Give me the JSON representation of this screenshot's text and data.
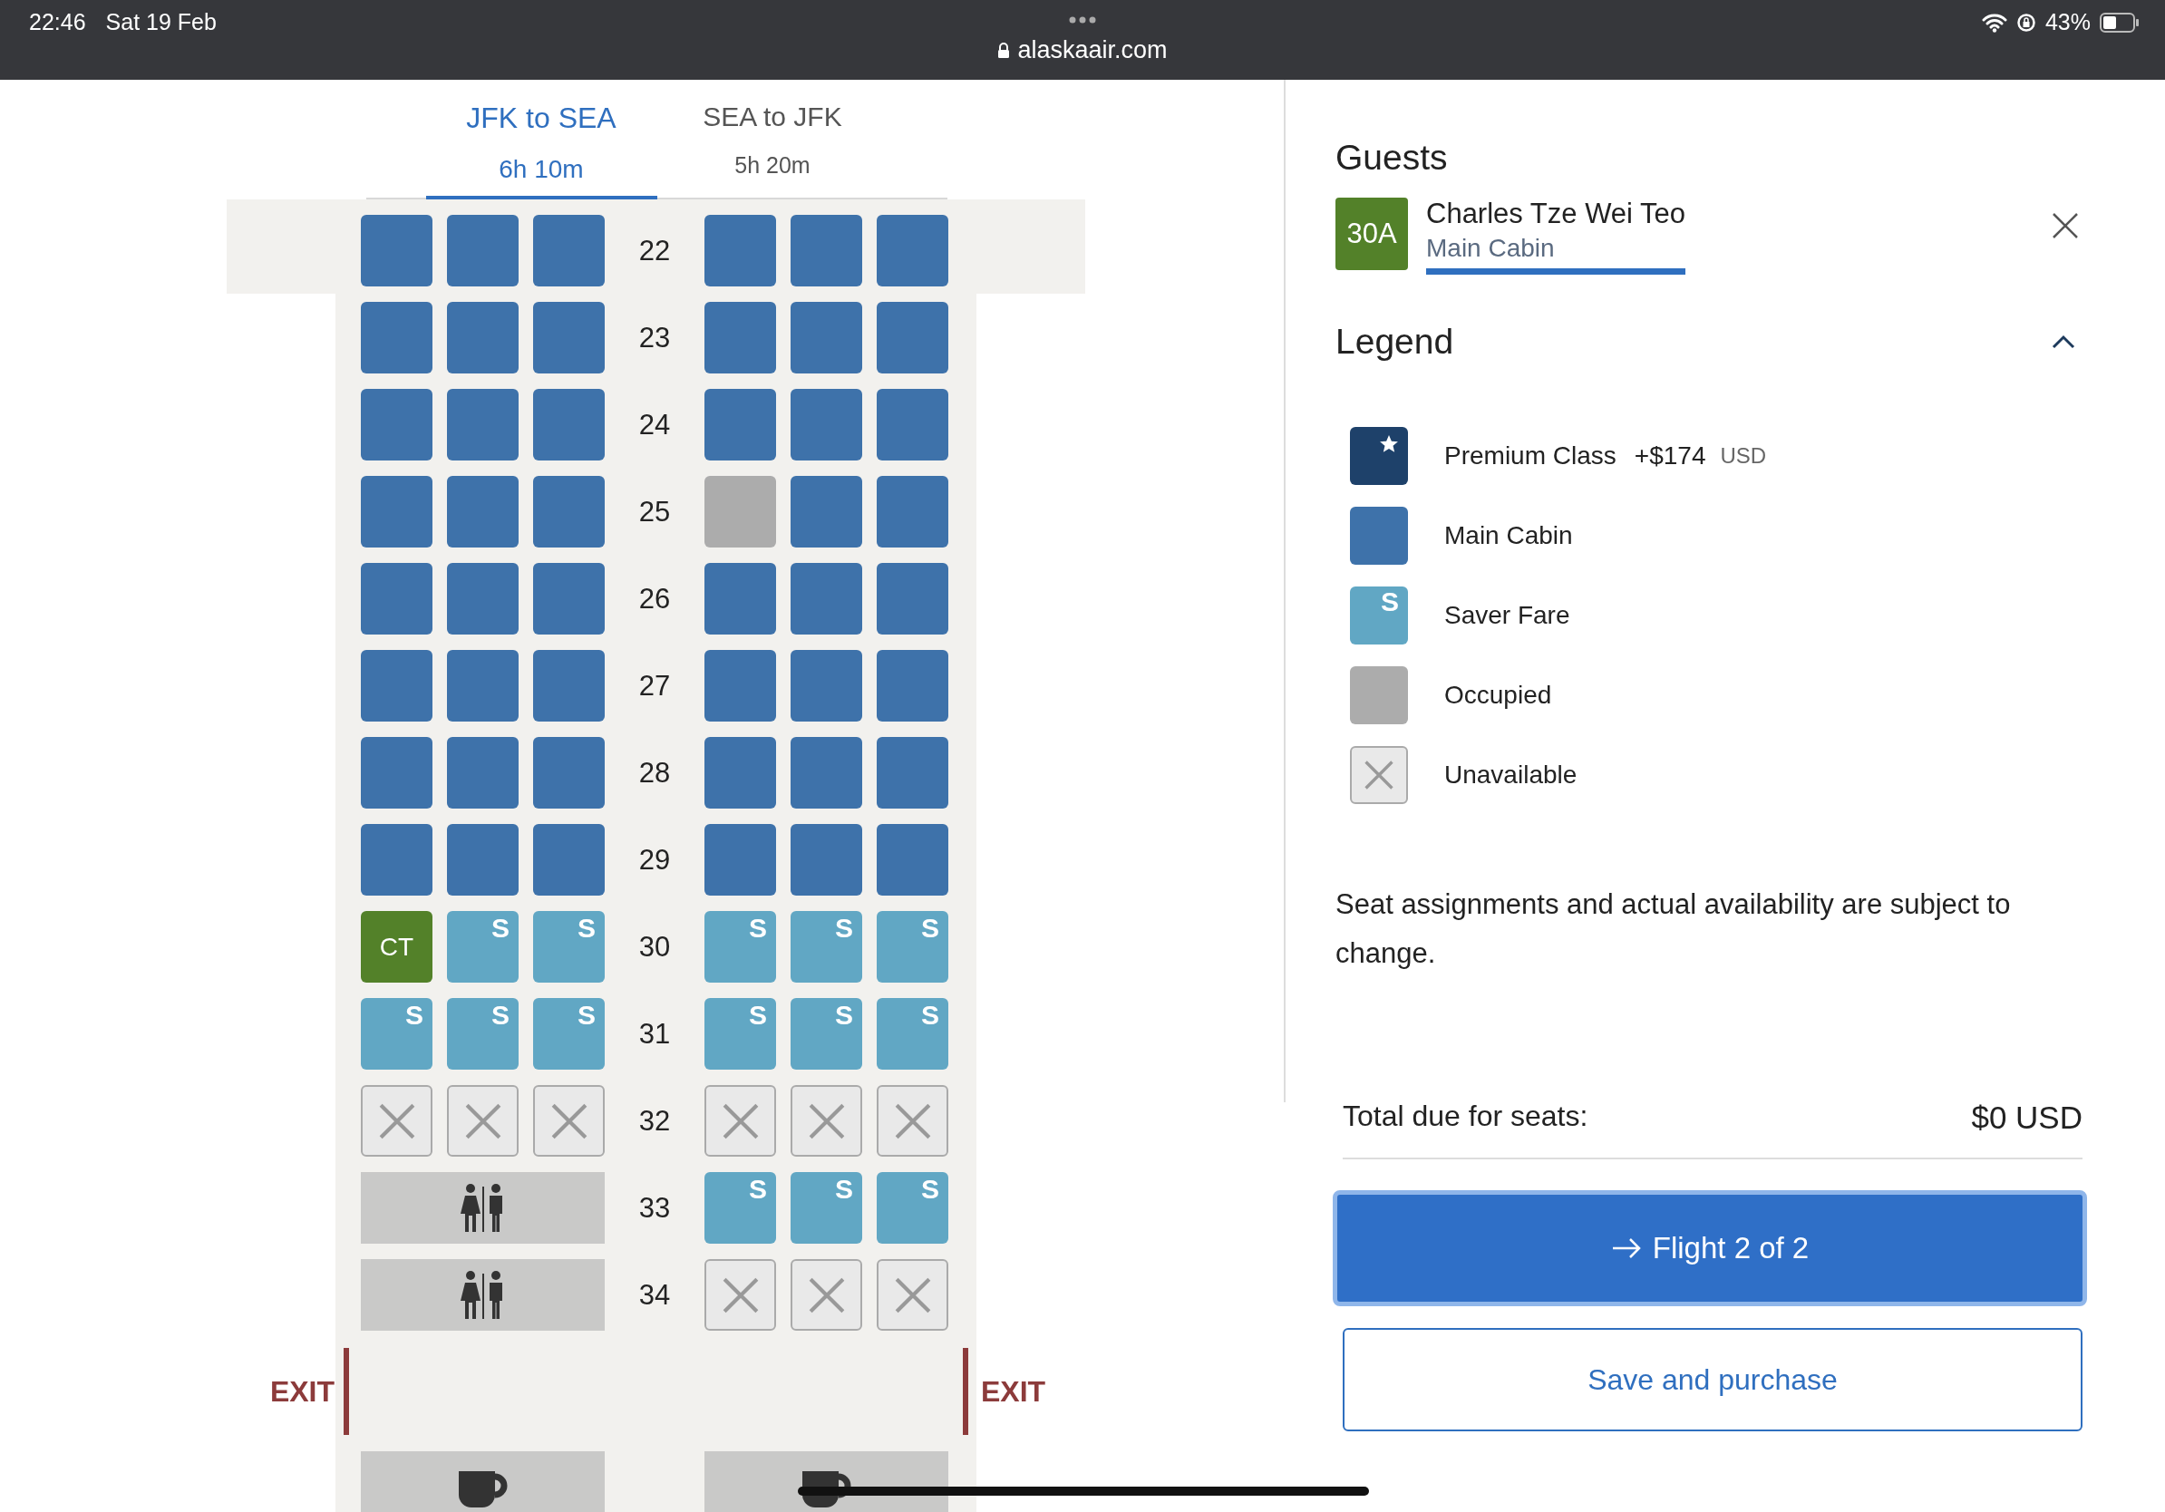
{
  "status_bar": {
    "time": "22:46",
    "date": "Sat 19 Feb",
    "url": "alaskaair.com",
    "battery": "43%"
  },
  "tabs": [
    {
      "route": "JFK to SEA",
      "duration": "6h 10m",
      "selected": true
    },
    {
      "route": "SEA to JFK",
      "duration": "5h 20m",
      "selected": false
    }
  ],
  "seat_map": {
    "rows": [
      {
        "kind": "seats",
        "number": "22",
        "left": [
          {
            "kind": "main"
          },
          {
            "kind": "main"
          },
          {
            "kind": "main"
          }
        ],
        "right": [
          {
            "kind": "main"
          },
          {
            "kind": "main"
          },
          {
            "kind": "main"
          }
        ]
      },
      {
        "kind": "seats",
        "number": "23",
        "left": [
          {
            "kind": "main"
          },
          {
            "kind": "main"
          },
          {
            "kind": "main"
          }
        ],
        "right": [
          {
            "kind": "main"
          },
          {
            "kind": "main"
          },
          {
            "kind": "main"
          }
        ]
      },
      {
        "kind": "seats",
        "number": "24",
        "left": [
          {
            "kind": "main"
          },
          {
            "kind": "main"
          },
          {
            "kind": "main"
          }
        ],
        "right": [
          {
            "kind": "main"
          },
          {
            "kind": "main"
          },
          {
            "kind": "main"
          }
        ]
      },
      {
        "kind": "seats",
        "number": "25",
        "left": [
          {
            "kind": "main"
          },
          {
            "kind": "main"
          },
          {
            "kind": "main"
          }
        ],
        "right": [
          {
            "kind": "occupied"
          },
          {
            "kind": "main"
          },
          {
            "kind": "main"
          }
        ]
      },
      {
        "kind": "seats",
        "number": "26",
        "left": [
          {
            "kind": "main"
          },
          {
            "kind": "main"
          },
          {
            "kind": "main"
          }
        ],
        "right": [
          {
            "kind": "main"
          },
          {
            "kind": "main"
          },
          {
            "kind": "main"
          }
        ]
      },
      {
        "kind": "seats",
        "number": "27",
        "left": [
          {
            "kind": "main"
          },
          {
            "kind": "main"
          },
          {
            "kind": "main"
          }
        ],
        "right": [
          {
            "kind": "main"
          },
          {
            "kind": "main"
          },
          {
            "kind": "main"
          }
        ]
      },
      {
        "kind": "seats",
        "number": "28",
        "left": [
          {
            "kind": "main"
          },
          {
            "kind": "main"
          },
          {
            "kind": "main"
          }
        ],
        "right": [
          {
            "kind": "main"
          },
          {
            "kind": "main"
          },
          {
            "kind": "main"
          }
        ]
      },
      {
        "kind": "seats",
        "number": "29",
        "left": [
          {
            "kind": "main"
          },
          {
            "kind": "main"
          },
          {
            "kind": "main"
          }
        ],
        "right": [
          {
            "kind": "main"
          },
          {
            "kind": "main"
          },
          {
            "kind": "main"
          }
        ]
      },
      {
        "kind": "seats",
        "number": "30",
        "left": [
          {
            "kind": "selected",
            "label": "CT"
          },
          {
            "kind": "saver",
            "label": "S"
          },
          {
            "kind": "saver",
            "label": "S"
          }
        ],
        "right": [
          {
            "kind": "saver",
            "label": "S"
          },
          {
            "kind": "saver",
            "label": "S"
          },
          {
            "kind": "saver",
            "label": "S"
          }
        ]
      },
      {
        "kind": "seats",
        "number": "31",
        "left": [
          {
            "kind": "saver",
            "label": "S"
          },
          {
            "kind": "saver",
            "label": "S"
          },
          {
            "kind": "saver",
            "label": "S"
          }
        ],
        "right": [
          {
            "kind": "saver",
            "label": "S"
          },
          {
            "kind": "saver",
            "label": "S"
          },
          {
            "kind": "saver",
            "label": "S"
          }
        ]
      },
      {
        "kind": "seats",
        "number": "32",
        "left": [
          {
            "kind": "unavailable"
          },
          {
            "kind": "unavailable"
          },
          {
            "kind": "unavailable"
          }
        ],
        "right": [
          {
            "kind": "unavailable"
          },
          {
            "kind": "unavailable"
          },
          {
            "kind": "unavailable"
          }
        ]
      },
      {
        "kind": "seats",
        "number": "33",
        "left": [
          {
            "kind": "lavatory"
          }
        ],
        "right": [
          {
            "kind": "saver",
            "label": "S"
          },
          {
            "kind": "saver",
            "label": "S"
          },
          {
            "kind": "saver",
            "label": "S"
          }
        ]
      },
      {
        "kind": "seats",
        "number": "34",
        "left": [
          {
            "kind": "lavatory"
          }
        ],
        "right": [
          {
            "kind": "unavailable"
          },
          {
            "kind": "unavailable"
          },
          {
            "kind": "unavailable"
          }
        ]
      },
      {
        "kind": "exit",
        "left_label": "EXIT",
        "right_label": "EXIT"
      },
      {
        "kind": "seats",
        "left": [
          {
            "kind": "galley"
          }
        ],
        "right": [
          {
            "kind": "galley"
          }
        ]
      }
    ]
  },
  "guests": {
    "title": "Guests",
    "items": [
      {
        "seat": "30A",
        "name": "Charles Tze Wei Teo",
        "cabin": "Main Cabin",
        "selected": true
      }
    ]
  },
  "legend": {
    "title": "Legend",
    "expanded": true,
    "items": [
      {
        "kind": "premium",
        "label": "Premium Class",
        "price": "+$174",
        "currency": "USD"
      },
      {
        "kind": "main",
        "label": "Main Cabin"
      },
      {
        "kind": "saver",
        "label": "Saver Fare",
        "mark": "S"
      },
      {
        "kind": "occupied",
        "label": "Occupied"
      },
      {
        "kind": "unavailable",
        "label": "Unavailable"
      }
    ]
  },
  "note": "Seat assignments and actual availability are subject to change.",
  "total": {
    "label": "Total due for seats:",
    "amount": "$0 USD"
  },
  "buttons": {
    "primary": "Flight 2 of 2",
    "secondary": "Save and purchase"
  }
}
